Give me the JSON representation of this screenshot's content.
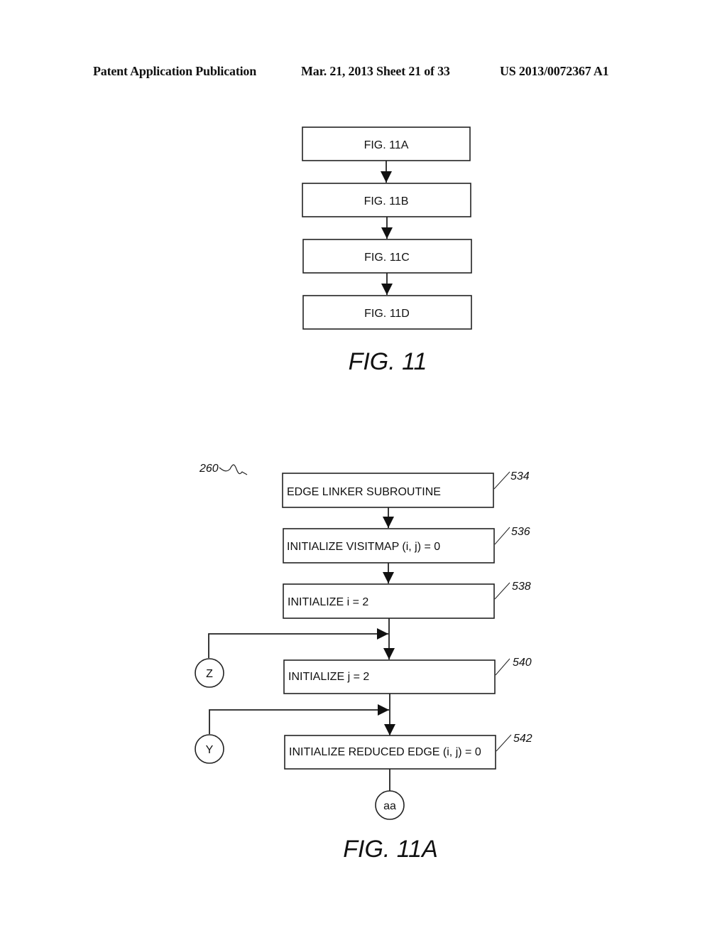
{
  "header": {
    "publication": "Patent Application Publication",
    "date_sheet": "Mar. 21, 2013  Sheet 21 of 33",
    "number": "US 2013/0072367 A1"
  },
  "fig11": {
    "boxes": [
      "FIG. 11A",
      "FIG. 11B",
      "FIG. 11C",
      "FIG. 11D"
    ],
    "caption": "FIG. 11"
  },
  "fig11a": {
    "ref_label": "260",
    "steps": [
      {
        "text": "EDGE LINKER SUBROUTINE",
        "ref": "534"
      },
      {
        "text": "INITIALIZE VISITMAP (i, j) = 0",
        "ref": "536"
      },
      {
        "text": "INITIALIZE i = 2",
        "ref": "538"
      },
      {
        "text": "INITIALIZE j = 2",
        "ref": "540"
      },
      {
        "text": "INITIALIZE REDUCED EDGE (i, j) = 0",
        "ref": "542"
      }
    ],
    "connectors": {
      "z": "Z",
      "y": "Y",
      "aa": "aa"
    },
    "caption": "FIG. 11A"
  }
}
